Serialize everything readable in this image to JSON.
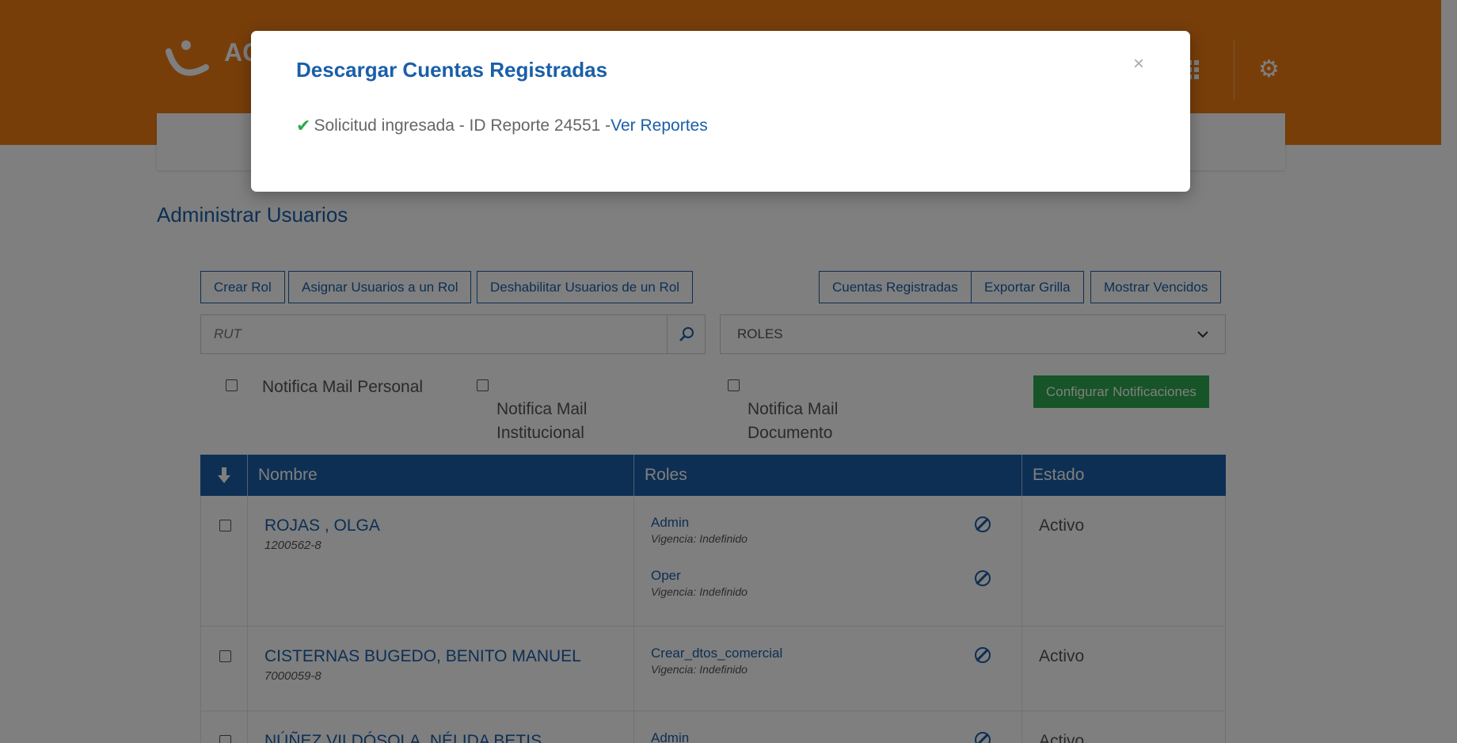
{
  "header": {
    "logo_text": "AC"
  },
  "page": {
    "title": "Administrar Usuarios"
  },
  "toolbar": {
    "crear_rol": "Crear Rol",
    "asignar": "Asignar Usuarios a un Rol",
    "deshabilitar": "Deshabilitar Usuarios de un Rol",
    "cuentas": "Cuentas Registradas",
    "exportar": "Exportar Grilla",
    "vencidos": "Mostrar Vencidos"
  },
  "search": {
    "placeholder": "RUT"
  },
  "roles_select": {
    "selected": "ROLES"
  },
  "notifications": {
    "personal": "Notifica Mail Personal",
    "institucional_1": "Notifica Mail",
    "institucional_2": "Institucional",
    "documento_1": "Notifica Mail",
    "documento_2": "Documento",
    "configurar": "Configurar Notificaciones"
  },
  "table": {
    "headers": {
      "nombre": "Nombre",
      "roles": "Roles",
      "estado": "Estado"
    },
    "rows": [
      {
        "name": "ROJAS , OLGA",
        "rut": "1200562-8",
        "roles": [
          {
            "name": "Admin",
            "vigencia": "Vigencia: Indefinido"
          },
          {
            "name": "Oper",
            "vigencia": "Vigencia: Indefinido"
          }
        ],
        "estado": "Activo"
      },
      {
        "name": "CISTERNAS BUGEDO, BENITO MANUEL",
        "rut": "7000059-8",
        "roles": [
          {
            "name": "Crear_dtos_comercial",
            "vigencia": "Vigencia: Indefinido"
          }
        ],
        "estado": "Activo"
      },
      {
        "name": "NÚÑEZ VILDÓSOLA, NÉLIDA BETIS",
        "rut": "",
        "roles": [
          {
            "name": "Admin",
            "vigencia": ""
          }
        ],
        "estado": "Activo"
      }
    ]
  },
  "modal": {
    "title": "Descargar Cuentas Registradas",
    "close": "×",
    "message": "Solicitud ingresada - ID Reporte 24551 - ",
    "link": "Ver Reportes"
  },
  "colors": {
    "header_orange": "#f07d15",
    "primary_blue": "#1a5fa8",
    "success_green": "#2fa84f"
  }
}
